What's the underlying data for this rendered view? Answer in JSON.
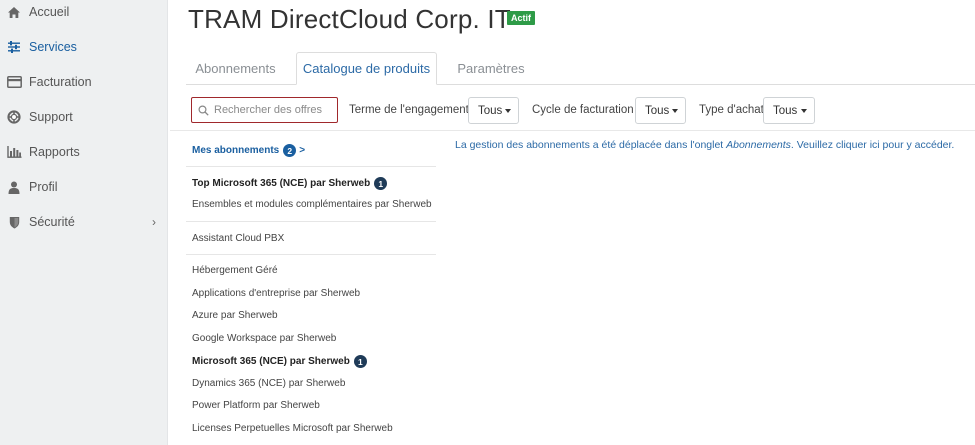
{
  "sidebar": {
    "items": [
      {
        "label": "Accueil",
        "icon": "home-icon"
      },
      {
        "label": "Services",
        "icon": "sliders-icon"
      },
      {
        "label": "Facturation",
        "icon": "credit-card-icon"
      },
      {
        "label": "Support",
        "icon": "lifebuoy-icon"
      },
      {
        "label": "Rapports",
        "icon": "bar-chart-icon"
      },
      {
        "label": "Profil",
        "icon": "user-icon"
      },
      {
        "label": "Sécurité",
        "icon": "shield-icon",
        "chevron": "›"
      }
    ],
    "active": "Services"
  },
  "header": {
    "title": "TRAM DirectCloud Corp. IT",
    "status_badge": "Actif"
  },
  "tabs": [
    {
      "label": "Abonnements"
    },
    {
      "label": "Catalogue de produits"
    },
    {
      "label": "Paramètres"
    }
  ],
  "active_tab": "Catalogue de produits",
  "filters": {
    "search_placeholder": "Rechercher des offres",
    "term_label": "Terme de l'engagement :",
    "term_value": "Tous",
    "billing_label": "Cycle de facturation :",
    "billing_value": "Tous",
    "purchase_label": "Type d'achat:",
    "purchase_value": "Tous"
  },
  "catalog": {
    "my_subscriptions": {
      "label": "Mes abonnements",
      "count": "2",
      "arrow": ">"
    },
    "top_item": {
      "label": "Top Microsoft 365 (NCE) par Sherweb",
      "count": "1"
    },
    "bundles": "Ensembles et modules complémentaires par Sherweb",
    "pbx": "Assistant Cloud PBX",
    "hosting": "Hébergement Géré",
    "apps": "Applications d'entreprise par Sherweb",
    "azure": "Azure par Sherweb",
    "google": "Google Workspace par Sherweb",
    "m365": {
      "label": "Microsoft 365 (NCE) par Sherweb",
      "count": "1"
    },
    "dynamics": "Dynamics 365 (NCE) par Sherweb",
    "power": "Power Platform par Sherweb",
    "perpetual": "Licenses Perpetuelles Microsoft par Sherweb"
  },
  "info_message": {
    "before": "La gestion des abonnements a été déplacée dans l'onglet ",
    "emphasis": "Abonnements",
    "after": ". Veuillez cliquer ici pour y accéder."
  },
  "colors": {
    "accent": "#1a5fa0",
    "badge": "#2e9b47",
    "search_border": "#a0282c"
  }
}
